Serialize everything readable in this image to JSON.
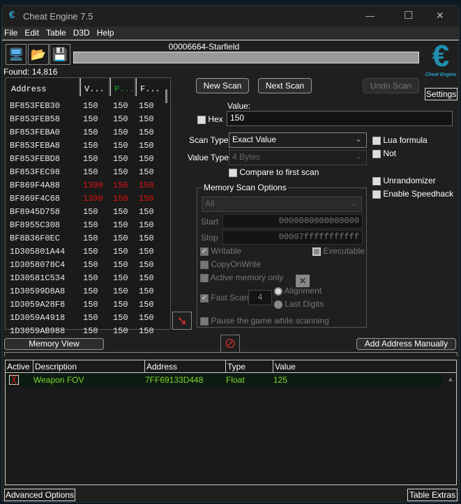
{
  "window": {
    "title": "Cheat Engine 7.5",
    "minimize": "—",
    "maximize": "☐",
    "close": "✕"
  },
  "menu": [
    "File",
    "Edit",
    "Table",
    "D3D",
    "Help"
  ],
  "process": "00006664-Starfield",
  "found": "Found: 14,816",
  "logo_text": "Cheat Engine",
  "results": {
    "columns": [
      "Address",
      "V...",
      "P...",
      "F..."
    ],
    "rows": [
      [
        "BF853FEB30",
        "150",
        "150",
        "150",
        false
      ],
      [
        "BF853FEB58",
        "150",
        "150",
        "150",
        false
      ],
      [
        "BF853FEBA0",
        "150",
        "150",
        "150",
        false
      ],
      [
        "BF853FEBA8",
        "150",
        "150",
        "150",
        false
      ],
      [
        "BF853FEBD8",
        "150",
        "150",
        "150",
        false
      ],
      [
        "BF853FEC98",
        "150",
        "150",
        "150",
        false
      ],
      [
        "BF869F4A88",
        "1390",
        "150",
        "150",
        true
      ],
      [
        "BF869F4C68",
        "1390",
        "150",
        "150",
        true
      ],
      [
        "BF8945D758",
        "150",
        "150",
        "150",
        false
      ],
      [
        "BF8955C308",
        "150",
        "150",
        "150",
        false
      ],
      [
        "BF8B36F0EC",
        "150",
        "150",
        "150",
        false
      ],
      [
        "1D305801A44",
        "150",
        "150",
        "150",
        false
      ],
      [
        "1D3058078C4",
        "150",
        "150",
        "150",
        false
      ],
      [
        "1D30581C534",
        "150",
        "150",
        "150",
        false
      ],
      [
        "1D30599D8A8",
        "150",
        "150",
        "150",
        false
      ],
      [
        "1D3059A28F8",
        "150",
        "150",
        "150",
        false
      ],
      [
        "1D3059A4918",
        "150",
        "150",
        "150",
        false
      ],
      [
        "1D3059AB988",
        "150",
        "150",
        "150",
        false
      ]
    ]
  },
  "buttons": {
    "new_scan": "New Scan",
    "next_scan": "Next Scan",
    "undo_scan": "Undo Scan",
    "settings": "Settings",
    "memory_view": "Memory View",
    "add_address": "Add Address Manually"
  },
  "scan": {
    "value_label": "Value:",
    "hex": "Hex",
    "value": "150",
    "scan_type_label": "Scan Type",
    "scan_type": "Exact Value",
    "value_type_label": "Value Type",
    "value_type": "4 Bytes",
    "compare_first": "Compare to first scan",
    "lua_formula": "Lua formula",
    "not": "Not",
    "unrandomizer": "Unrandomizer",
    "speedhack": "Enable Speedhack"
  },
  "memory_options": {
    "title": "Memory Scan Options",
    "region": "All",
    "start_label": "Start",
    "start": "0000000000000000",
    "stop_label": "Stop",
    "stop": "00007fffffffffff",
    "writable": "Writable",
    "executable": "Executable",
    "copy_on_write": "CopyOnWrite",
    "active_memory": "Active memory only",
    "fast_scan": "Fast Scan",
    "fast_scan_value": "4",
    "alignment": "Alignment",
    "last_digits": "Last Digits",
    "pause_game": "Pause the game while scanning"
  },
  "address_table": {
    "columns": [
      "Active",
      "Description",
      "Address",
      "Type",
      "Value"
    ],
    "rows": [
      {
        "description": "Weapon FOV",
        "address": "7FF69133D448",
        "type": "Float",
        "value": "125"
      }
    ]
  },
  "footer": {
    "advanced": "Advanced Options",
    "extras": "Table Extras"
  }
}
